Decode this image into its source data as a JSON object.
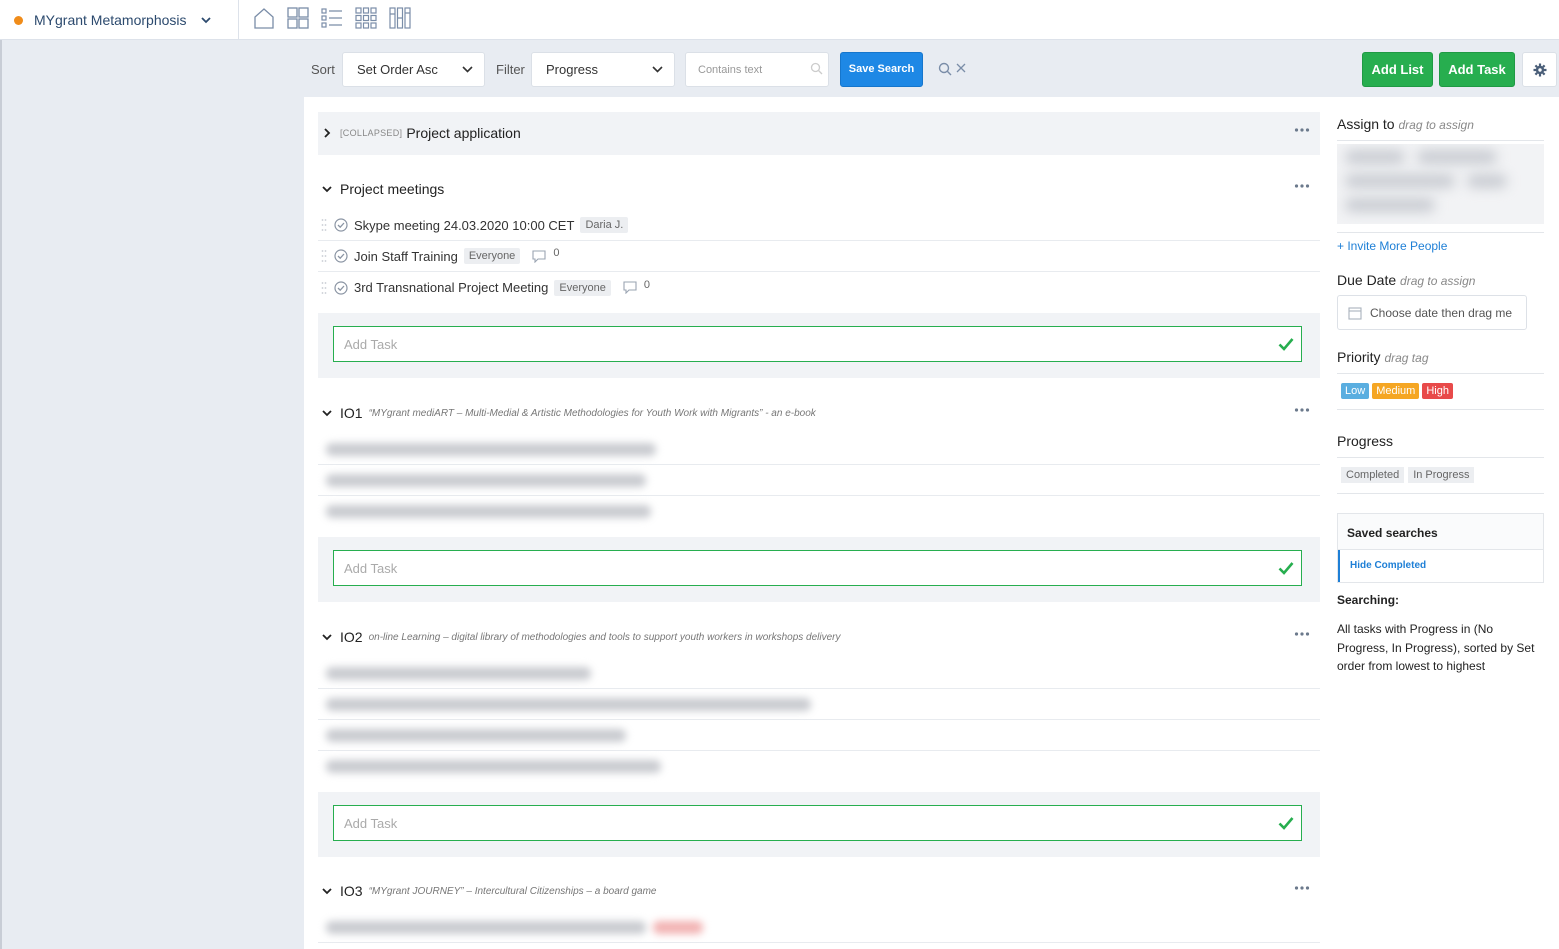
{
  "project": {
    "name": "MYgrant Metamorphosis",
    "dot_color": "#f08c1a"
  },
  "toolbar": {
    "sort_label": "Sort",
    "sort_value": "Set Order Asc",
    "filter_label": "Filter",
    "filter_value": "Progress",
    "search_placeholder": "Contains text",
    "save_search": "Save Search",
    "add_list": "Add List",
    "add_task": "Add Task"
  },
  "lists": [
    {
      "collapsed_tag": "[COLLAPSED]",
      "title": "Project application"
    },
    {
      "title": "Project meetings",
      "tasks": [
        {
          "title": "Skype meeting 24.03.2020 10:00 CET",
          "assignee": "Daria J."
        },
        {
          "title": "Join Staff Training",
          "assignee": "Everyone",
          "comments": "0"
        },
        {
          "title": "3rd Transnational Project Meeting",
          "assignee": "Everyone",
          "comments": "0"
        }
      ],
      "add_placeholder": "Add Task"
    },
    {
      "title": "IO1",
      "description": "“MYgrant mediART – Multi-Medial & Artistic Methodologies for Youth Work with Migrants” - an e-book",
      "add_placeholder": "Add Task"
    },
    {
      "title": "IO2",
      "description": "on-line Learning – digital library of methodologies and tools to support youth workers in workshops delivery",
      "add_placeholder": "Add Task"
    },
    {
      "title": "IO3",
      "description": "“MYgrant JOURNEY” – Intercultural Citizenships – a board game"
    }
  ],
  "right_panel": {
    "assign_title": "Assign to",
    "assign_hint": "drag to assign",
    "invite": "+ Invite More People",
    "due_title": "Due Date",
    "due_hint": "drag to assign",
    "due_placeholder": "Choose date then drag me",
    "priority_title": "Priority",
    "priority_hint": "drag tag",
    "priorities": [
      {
        "label": "Low",
        "color": "#5aaee0"
      },
      {
        "label": "Medium",
        "color": "#f5a623"
      },
      {
        "label": "High",
        "color": "#e84a4a"
      }
    ],
    "progress_title": "Progress",
    "progress_tags": [
      "Completed",
      "In Progress"
    ],
    "saved_title": "Saved searches",
    "saved_items": [
      "Hide Completed"
    ],
    "searching_title": "Searching:",
    "searching_text": "All tasks with Progress in (No Progress, In Progress), sorted by Set order from lowest to highest"
  },
  "colors": {
    "accent_blue": "#1e88e5",
    "accent_green": "#27ae4f"
  }
}
